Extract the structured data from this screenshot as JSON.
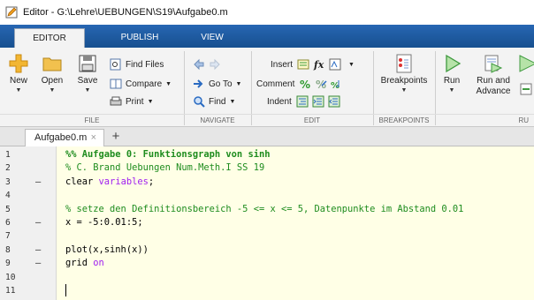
{
  "window": {
    "title": "Editor - G:\\Lehre\\UEBUNGEN\\S19\\Aufgabe0.m"
  },
  "ribbon_tabs": [
    {
      "label": "EDITOR",
      "active": true
    },
    {
      "label": "PUBLISH",
      "active": false
    },
    {
      "label": "VIEW",
      "active": false
    }
  ],
  "file_group": {
    "label": "FILE",
    "new": "New",
    "open": "Open",
    "save": "Save",
    "find_files": "Find Files",
    "compare": "Compare",
    "print": "Print"
  },
  "navigate_group": {
    "label": "NAVIGATE",
    "goto": "Go To",
    "find": "Find"
  },
  "edit_group": {
    "label": "EDIT",
    "insert": "Insert",
    "comment": "Comment",
    "indent": "Indent"
  },
  "breakpoints_group": {
    "label": "BREAKPOINTS",
    "breakpoints": "Breakpoints"
  },
  "run_group": {
    "label": "RU",
    "run": "Run",
    "run_and_advance_1": "Run and",
    "run_and_advance_2": "Advance"
  },
  "file_tab": {
    "name": "Aufgabe0.m",
    "close": "×",
    "add": "+"
  },
  "editor": {
    "lines": [
      {
        "num": "1",
        "dash": "",
        "segments": [
          {
            "t": "%% Aufgabe 0: Funktionsgraph von sinh",
            "c": "c-cell"
          }
        ]
      },
      {
        "num": "2",
        "dash": "",
        "segments": [
          {
            "t": "% C. Brand Uebungen Num.Meth.I SS 19",
            "c": "c-comment"
          }
        ]
      },
      {
        "num": "3",
        "dash": "—",
        "segments": [
          {
            "t": "clear ",
            "c": ""
          },
          {
            "t": "variables",
            "c": "c-var"
          },
          {
            "t": ";",
            "c": ""
          }
        ]
      },
      {
        "num": "4",
        "dash": "",
        "segments": []
      },
      {
        "num": "5",
        "dash": "",
        "segments": [
          {
            "t": "% setze den Definitionsbereich -5 <= x <= 5, Datenpunkte im Abstand 0.01",
            "c": "c-comment"
          }
        ]
      },
      {
        "num": "6",
        "dash": "—",
        "segments": [
          {
            "t": "x = -5:0.01:5;",
            "c": ""
          }
        ]
      },
      {
        "num": "7",
        "dash": "",
        "segments": []
      },
      {
        "num": "8",
        "dash": "—",
        "segments": [
          {
            "t": "plot(x,sinh(x))",
            "c": ""
          }
        ]
      },
      {
        "num": "9",
        "dash": "—",
        "segments": [
          {
            "t": "grid ",
            "c": ""
          },
          {
            "t": "on",
            "c": "c-var"
          }
        ]
      },
      {
        "num": "10",
        "dash": "",
        "segments": []
      },
      {
        "num": "11",
        "dash": "",
        "segments": []
      }
    ]
  },
  "colors": {
    "ribbon_blue": "#1d5aa6",
    "editor_bg": "#ffffe6",
    "comment_green": "#1e8c1e",
    "keyword_purple": "#a020f0"
  },
  "icons": {
    "app": "editor-pencil-icon",
    "new": "new-plus-icon",
    "open": "open-folder-icon",
    "save": "save-disk-icon",
    "run": "run-triangle-icon"
  }
}
